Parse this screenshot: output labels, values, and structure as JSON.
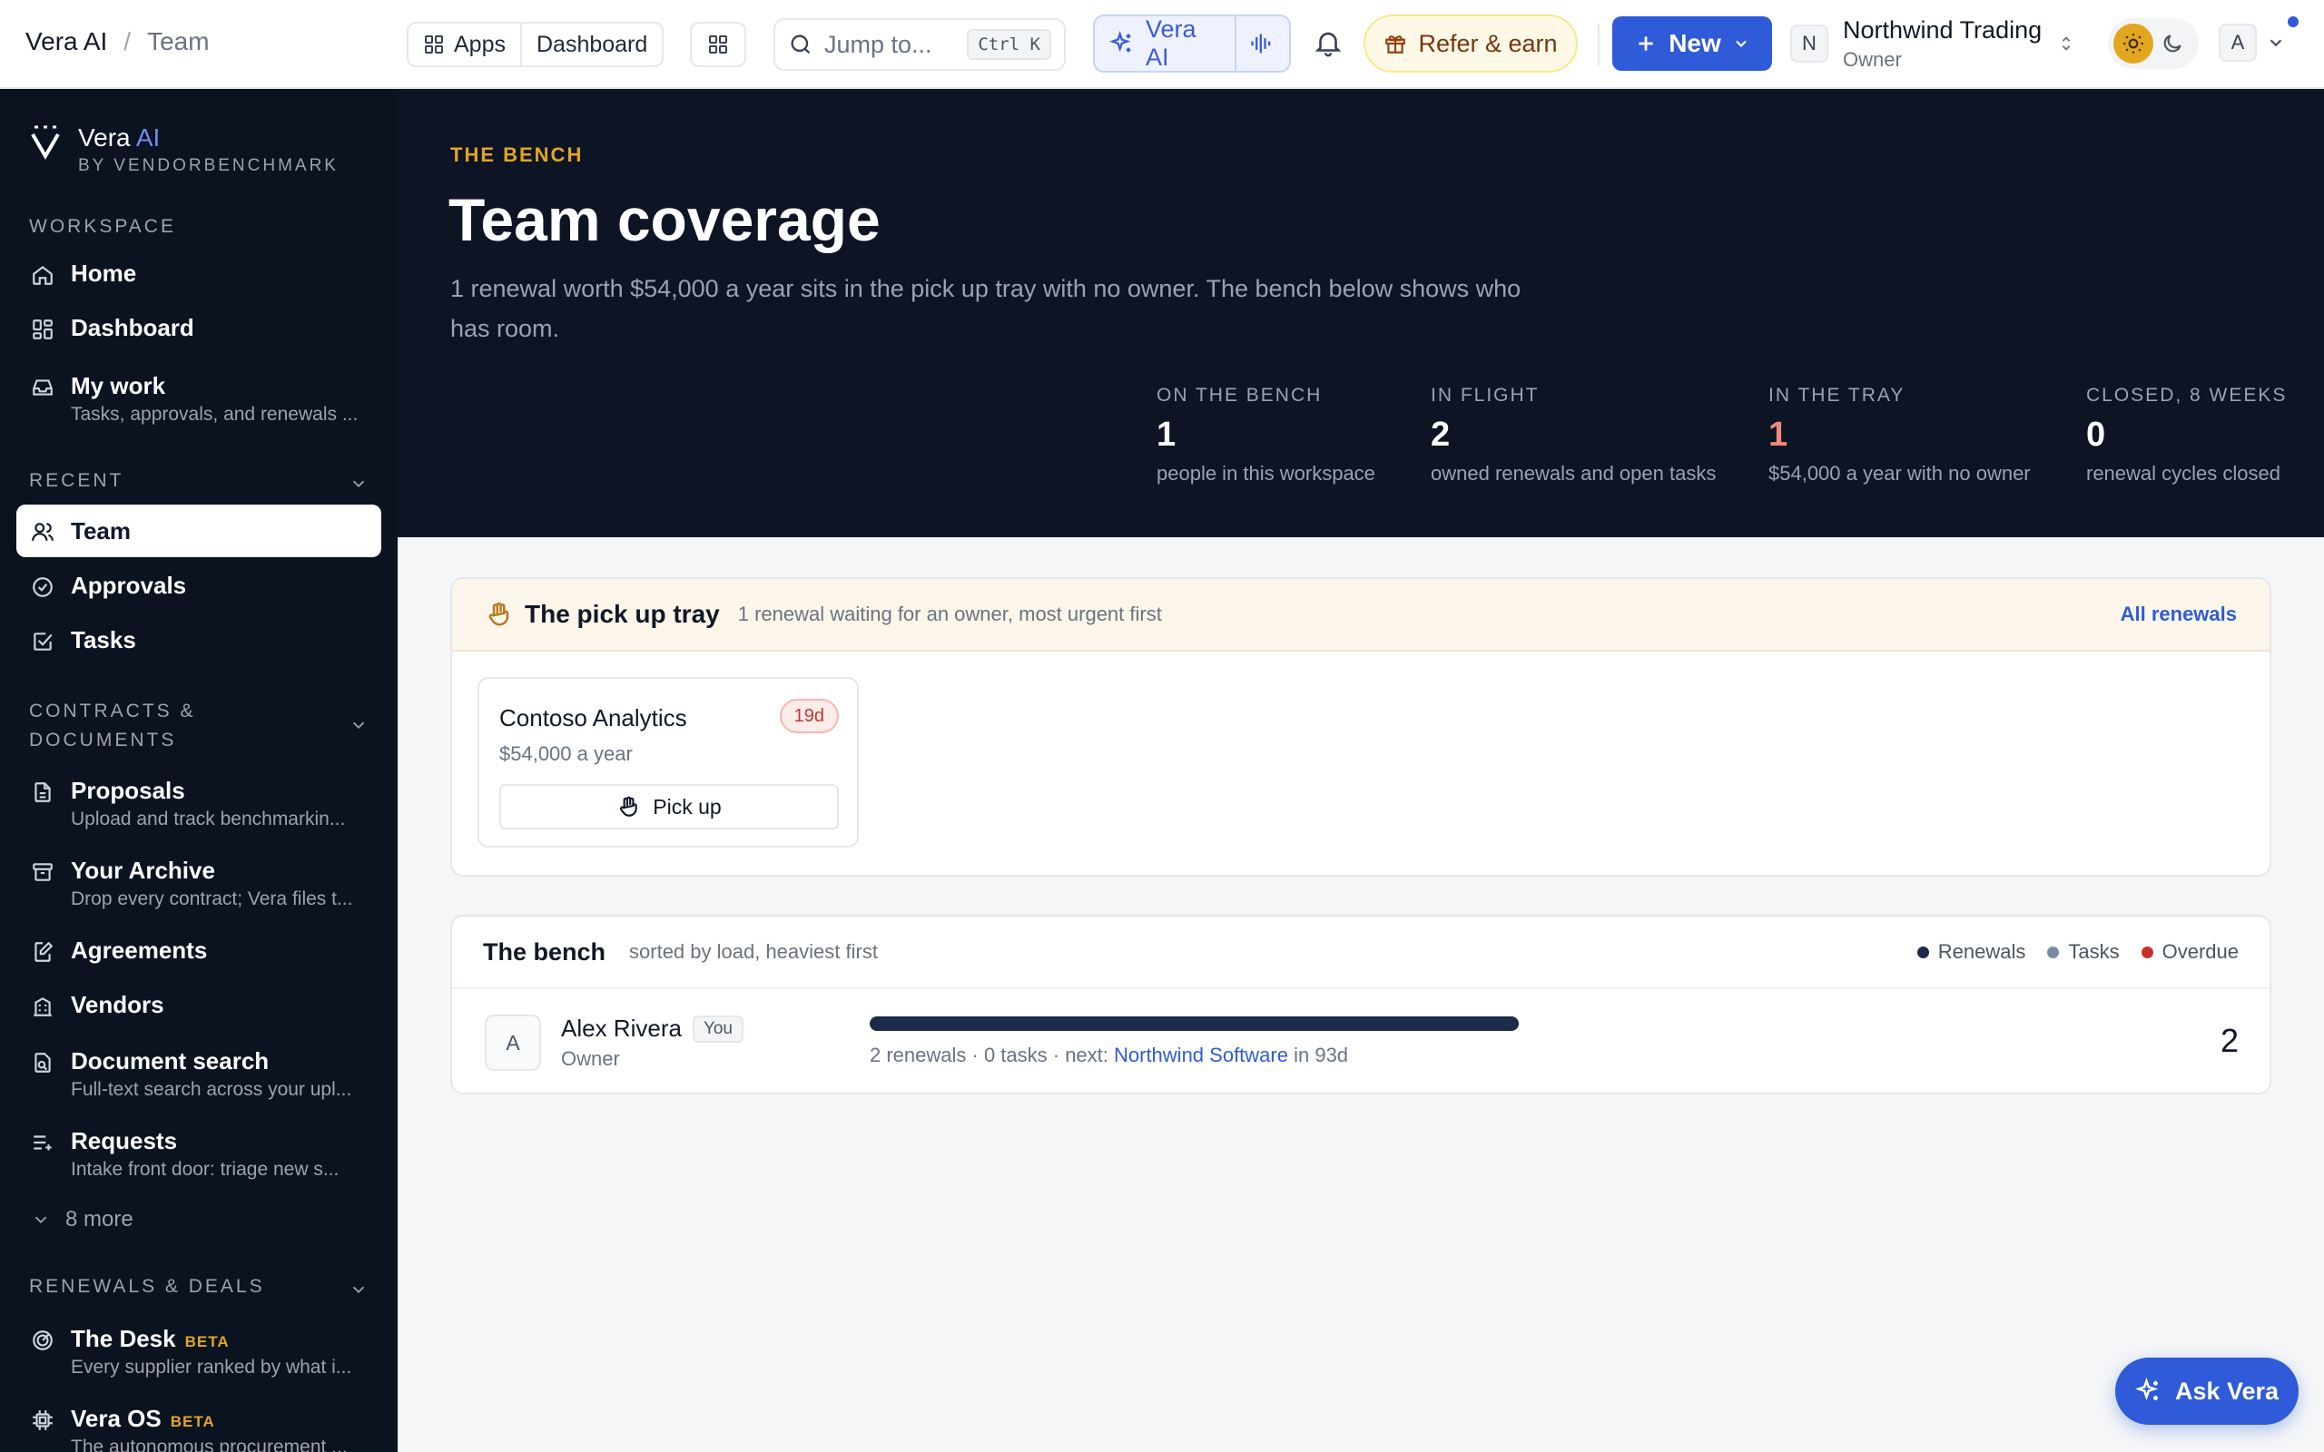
{
  "breadcrumb": {
    "app": "Vera AI",
    "separator": "/",
    "page": "Team"
  },
  "topbar": {
    "apps_label": "Apps",
    "dashboard_label": "Dashboard",
    "search_placeholder": "Jump to...",
    "search_shortcut": "Ctrl K",
    "vera_label": "Vera AI",
    "refer_label": "Refer & earn",
    "new_label": "New",
    "org_initial": "N",
    "org_name": "Northwind Trading",
    "org_role": "Owner",
    "user_initial": "A"
  },
  "sidebar": {
    "brand_name": "Vera",
    "brand_ai": "AI",
    "brand_sub": "BY VENDORBENCHMARK",
    "workspace_label": "WORKSPACE",
    "workspace": [
      {
        "label": "Home",
        "icon": "home-icon"
      },
      {
        "label": "Dashboard",
        "icon": "dashboard-icon"
      },
      {
        "label": "My work",
        "sub": "Tasks, approvals, and renewals ...",
        "icon": "inbox-icon"
      }
    ],
    "recent_label": "RECENT",
    "recent": [
      {
        "label": "Team",
        "icon": "users-icon",
        "active": true
      },
      {
        "label": "Approvals",
        "icon": "check-circle-icon"
      },
      {
        "label": "Tasks",
        "icon": "checkbox-icon"
      }
    ],
    "contracts_label": "CONTRACTS & DOCUMENTS",
    "contracts": [
      {
        "label": "Proposals",
        "sub": "Upload and track benchmarkin...",
        "icon": "file-icon"
      },
      {
        "label": "Your Archive",
        "sub": "Drop every contract; Vera files t...",
        "icon": "archive-icon"
      },
      {
        "label": "Agreements",
        "icon": "edit-file-icon"
      },
      {
        "label": "Vendors",
        "icon": "building-icon"
      },
      {
        "label": "Document search",
        "sub": "Full-text search across your upl...",
        "icon": "search-file-icon"
      },
      {
        "label": "Requests",
        "sub": "Intake front door: triage new s...",
        "icon": "list-plus-icon"
      }
    ],
    "more_label": "8 more",
    "renewals_label": "RENEWALS & DEALS",
    "renewals": [
      {
        "label": "The Desk",
        "badge": "BETA",
        "sub": "Every supplier ranked by what i...",
        "icon": "radar-icon"
      },
      {
        "label": "Vera OS",
        "badge": "BETA",
        "sub": "The autonomous procurement ...",
        "icon": "chip-icon"
      }
    ]
  },
  "hero": {
    "eyebrow": "THE BENCH",
    "title": "Team coverage",
    "lede": "1 renewal worth $54,000 a year sits in the pick up tray with no owner. The bench below shows who has room.",
    "stats": [
      {
        "key": "ON THE BENCH",
        "value": "1",
        "desc": "people in this workspace"
      },
      {
        "key": "IN FLIGHT",
        "value": "2",
        "desc": "owned renewals and open tasks"
      },
      {
        "key": "IN THE TRAY",
        "value": "1",
        "desc": "$54,000 a year with no owner"
      },
      {
        "key": "CLOSED, 8 WEEKS",
        "value": "0",
        "desc": "renewal cycles closed"
      }
    ]
  },
  "tray": {
    "title": "The pick up tray",
    "subtitle": "1 renewal waiting for an owner, most urgent first",
    "link": "All renewals",
    "items": [
      {
        "name": "Contoso Analytics",
        "badge": "19d",
        "value": "$54,000 a year",
        "action": "Pick up"
      }
    ]
  },
  "bench": {
    "title": "The bench",
    "subtitle": "sorted by load, heaviest first",
    "legend": [
      {
        "label": "Renewals",
        "color": "#1c2b4a"
      },
      {
        "label": "Tasks",
        "color": "#7a8aa6"
      },
      {
        "label": "Overdue",
        "color": "#c8312b"
      }
    ],
    "rows": [
      {
        "initial": "A",
        "name": "Alex Rivera",
        "tag": "You",
        "role": "Owner",
        "meta_prefix": "2 renewals · 0 tasks · next: ",
        "next_link": "Northwind Software",
        "meta_suffix": " in 93d",
        "count": "2",
        "load_fraction": 0.55
      }
    ]
  },
  "ask_label": "Ask Vera",
  "colors": {
    "accent": "#2f5bd8",
    "sidebar_bg": "#0b1220",
    "hero_bg": "#0d1424",
    "gold": "#e2a61f"
  }
}
